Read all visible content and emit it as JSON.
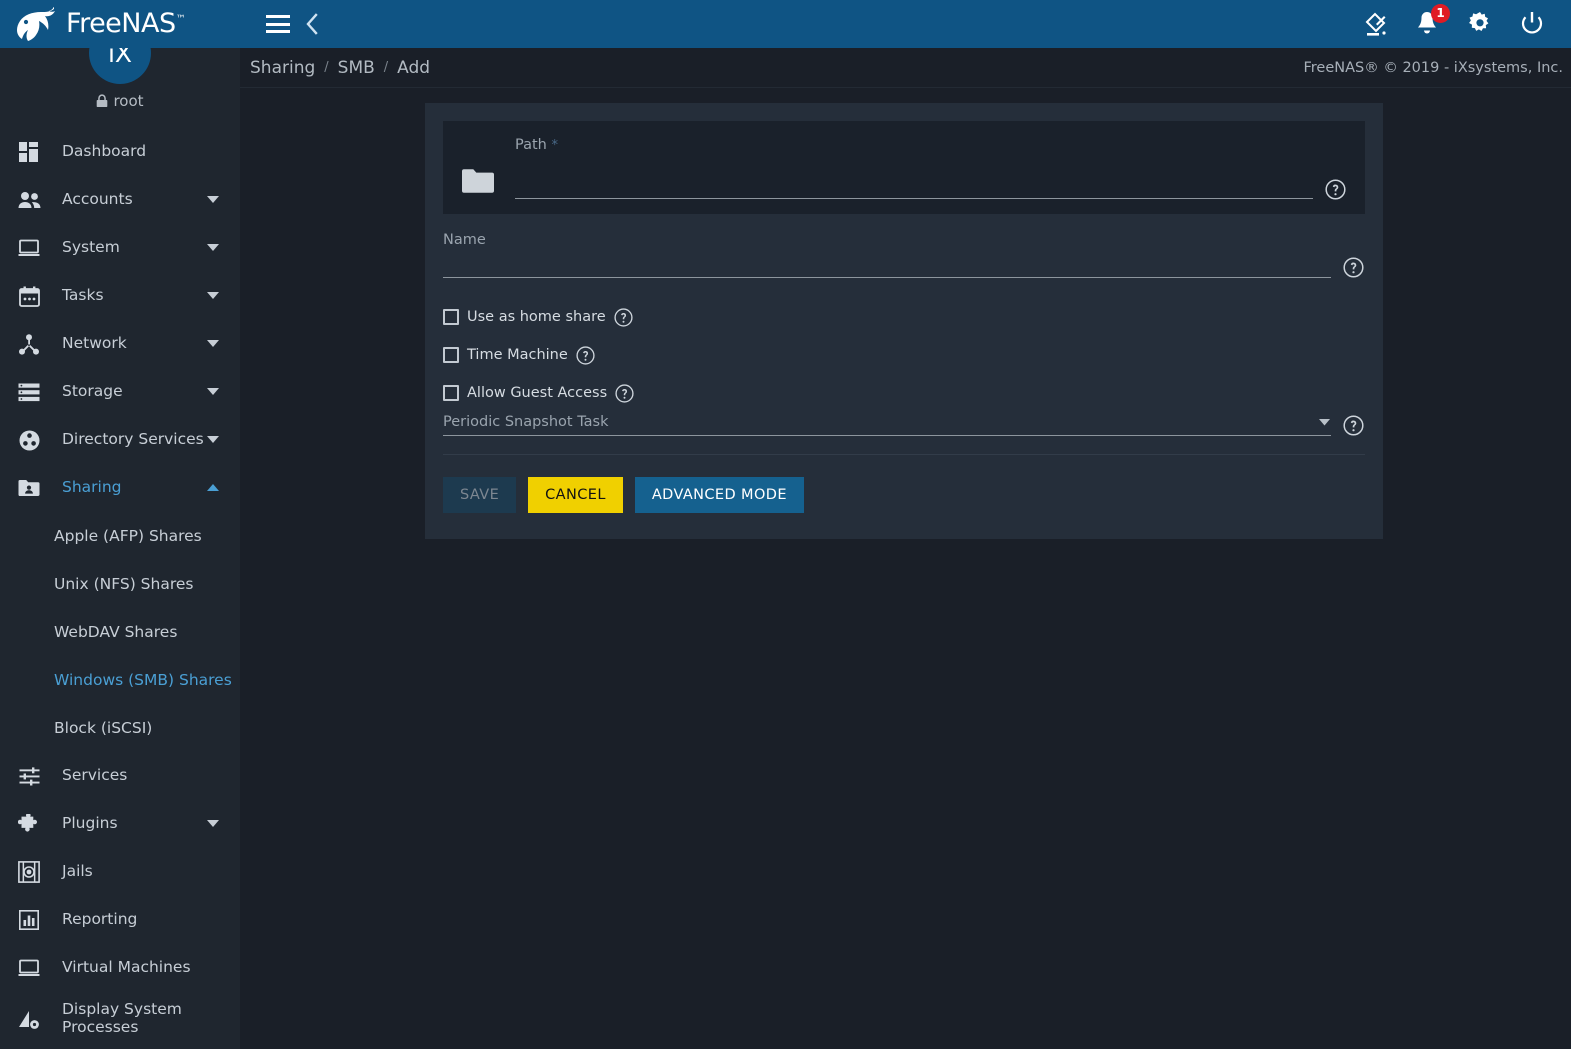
{
  "header": {
    "brand": "FreeNAS",
    "brand_tm": "™",
    "menu_icon": "hamburger-icon",
    "collapse_icon": "chevron-left-icon",
    "icons": [
      {
        "name": "theme-paint-icon",
        "label": ""
      },
      {
        "name": "notifications-bell-icon",
        "label": "",
        "badge": "1"
      },
      {
        "name": "settings-gear-icon",
        "label": ""
      },
      {
        "name": "power-icon",
        "label": ""
      }
    ]
  },
  "user": {
    "avatar_text": "iX",
    "username": "root",
    "lock_icon": "lock-icon"
  },
  "breadcrumb": {
    "items": [
      "Sharing",
      "SMB",
      "Add"
    ],
    "separator": "/"
  },
  "footer": {
    "copyright": "FreeNAS® © 2019 - iXsystems, Inc."
  },
  "sidebar": {
    "items": [
      {
        "label": "Dashboard",
        "icon": "dashboard-icon",
        "expandable": false,
        "active": false
      },
      {
        "label": "Accounts",
        "icon": "accounts-people-icon",
        "expandable": true,
        "active": false
      },
      {
        "label": "System",
        "icon": "system-monitor-icon",
        "expandable": true,
        "active": false
      },
      {
        "label": "Tasks",
        "icon": "tasks-calendar-icon",
        "expandable": true,
        "active": false
      },
      {
        "label": "Network",
        "icon": "network-share-icon",
        "expandable": true,
        "active": false
      },
      {
        "label": "Storage",
        "icon": "storage-stack-icon",
        "expandable": true,
        "active": false
      },
      {
        "label": "Directory Services",
        "icon": "directory-services-icon",
        "expandable": true,
        "active": false
      },
      {
        "label": "Sharing",
        "icon": "sharing-folder-icon",
        "expandable": true,
        "active": true,
        "expanded": true
      },
      {
        "label": "Services",
        "icon": "services-sliders-icon",
        "expandable": false,
        "active": false
      },
      {
        "label": "Plugins",
        "icon": "plugins-puzzle-icon",
        "expandable": true,
        "active": false
      },
      {
        "label": "Jails",
        "icon": "jails-icon",
        "expandable": false,
        "active": false
      },
      {
        "label": "Reporting",
        "icon": "reporting-chart-icon",
        "expandable": false,
        "active": false
      },
      {
        "label": "Virtual Machines",
        "icon": "virtual-machines-icon",
        "expandable": false,
        "active": false
      },
      {
        "label": "Display System Processes",
        "icon": "display-processes-icon",
        "expandable": false,
        "active": false
      }
    ],
    "sharing_children": [
      {
        "label": "Apple (AFP) Shares",
        "active": false
      },
      {
        "label": "Unix (NFS) Shares",
        "active": false
      },
      {
        "label": "WebDAV Shares",
        "active": false
      },
      {
        "label": "Windows (SMB) Shares",
        "active": true
      },
      {
        "label": "Block (iSCSI)",
        "active": false
      }
    ]
  },
  "form": {
    "path": {
      "label": "Path",
      "required_marker": "*",
      "value": "",
      "placeholder": "",
      "folder_icon": "folder-icon",
      "help_icon": "help-circle-icon"
    },
    "name": {
      "label": "Name",
      "value": "",
      "placeholder": "",
      "help_icon": "help-circle-icon"
    },
    "checkboxes": [
      {
        "label": "Use as home share",
        "checked": false,
        "help_icon": "help-circle-icon"
      },
      {
        "label": "Time Machine",
        "checked": false,
        "help_icon": "help-circle-icon"
      },
      {
        "label": "Allow Guest Access",
        "checked": false,
        "help_icon": "help-circle-icon"
      }
    ],
    "periodic_snapshot_task": {
      "label": "Periodic Snapshot Task",
      "value": "",
      "options": [],
      "dropdown_icon": "chevron-down-icon",
      "help_icon": "help-circle-icon"
    },
    "buttons": [
      {
        "label": "SAVE",
        "name": "save-button",
        "state": "disabled"
      },
      {
        "label": "CANCEL",
        "name": "cancel-button",
        "state": "enabled"
      },
      {
        "label": "ADVANCED MODE",
        "name": "advanced-mode-button",
        "state": "enabled"
      }
    ]
  },
  "colors": {
    "header_blue": "#0f5484",
    "page_bg": "#1a1f28",
    "sidebar_bg": "#1f262f",
    "card_bg": "#252e3a",
    "accent_blue": "#4a9fd4",
    "cancel_yellow": "#f0d000",
    "advanced_blue": "#15618f",
    "save_disabled": "#1d3a4f",
    "badge_red": "#e01b24"
  }
}
